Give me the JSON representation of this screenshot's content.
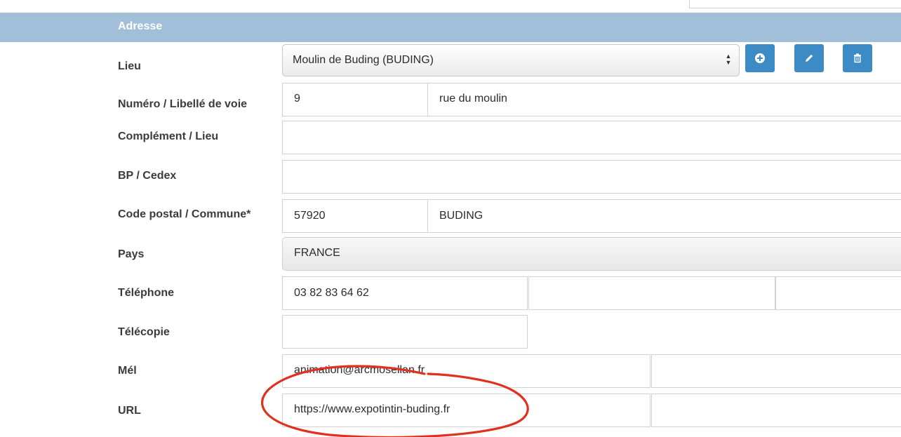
{
  "section": {
    "title": "Adresse"
  },
  "labels": {
    "lieu": "Lieu",
    "numero_voie": "Numéro / Libellé de voie",
    "complement": "Complément / Lieu",
    "bp_cedex": "BP / Cedex",
    "code_postal_commune": "Code postal / Commune*",
    "pays": "Pays",
    "telephone": "Téléphone",
    "telecopie": "Télécopie",
    "mel": "Mél",
    "url": "URL"
  },
  "fields": {
    "lieu_select": "Moulin de Buding (BUDING)",
    "numero": "9",
    "libelle_voie": "rue du moulin",
    "complement": "",
    "bp_cedex": "",
    "code_postal": "57920",
    "commune": "BUDING",
    "pays": "FRANCE",
    "telephone_1": "03 82 83 64 62",
    "telephone_2": "",
    "telephone_3": "",
    "telecopie": "",
    "mel_1": "animation@arcmosellan.fr",
    "mel_2": "",
    "url_1": "https://www.expotintin-buding.fr",
    "url_2": ""
  },
  "buttons": {
    "add_icon": "plus-circle-icon",
    "edit_icon": "pencil-icon",
    "delete_icon": "trash-icon"
  },
  "colors": {
    "header_bg": "#a2bfda",
    "button_bg": "#3d8bc4",
    "annotation": "#e0301e"
  }
}
